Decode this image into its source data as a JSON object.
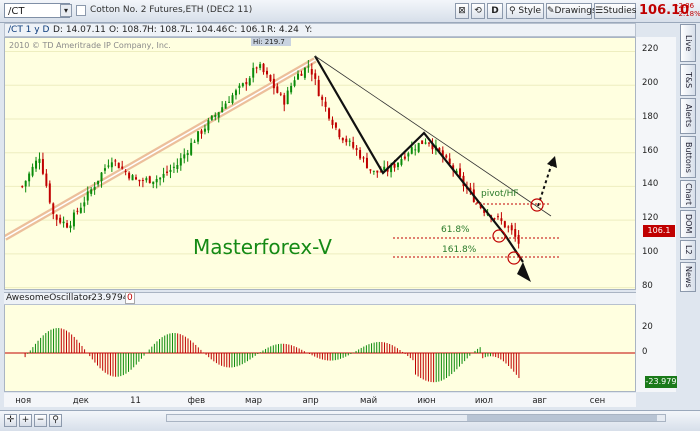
{
  "toolbar": {
    "symbol": "/CT",
    "description": "Cotton No. 2 Futures,ETH (DEC2 11)",
    "d_button": "D",
    "style_label": "Style",
    "drawings_label": "Drawings",
    "studies_label": "Studies",
    "last_price": "106.10",
    "change": "-2.36",
    "change_pct": "-2.18%"
  },
  "infobar": {
    "title": "/CT 1 y D",
    "date": "D: 14.07.11",
    "open": "O: 108.7",
    "high": "H: 108.7",
    "low": "L: 104.46",
    "close": "C: 106.1",
    "range": "R: 4.24",
    "y": "Y:"
  },
  "chart": {
    "copyright": "2010 © TD Ameritrade IP Company, Inc.",
    "hi_label": "Hi: 219.7",
    "watermark": "Masterforex-V",
    "label_pivot": "pivot/HF",
    "label_fib1": "61.8%",
    "label_fib2": "161.8%",
    "current_price_tag": "106.1",
    "colors": {
      "up": "#0a8a0a",
      "down": "#c00000",
      "background": "#ffffe0",
      "watermark": "#158a15",
      "trend_channel": "#e8a080"
    }
  },
  "chart_data": [
    {
      "type": "candlestick",
      "title": "/CT 1 y D",
      "y_ticks": [
        80,
        100,
        120,
        140,
        160,
        180,
        200,
        220
      ],
      "ylim": [
        78,
        228
      ],
      "x_tick_labels": [
        "ноя",
        "дек",
        "11",
        "фев",
        "мар",
        "апр",
        "май",
        "июн",
        "июл",
        "авг",
        "сен"
      ],
      "x_months": [
        0,
        1,
        2,
        3,
        4,
        5,
        6,
        7,
        8,
        9,
        10
      ],
      "close_series_approx": [
        {
          "m": 0.0,
          "v": 140
        },
        {
          "m": 0.3,
          "v": 158
        },
        {
          "m": 0.55,
          "v": 122
        },
        {
          "m": 0.8,
          "v": 117
        },
        {
          "m": 1.2,
          "v": 138
        },
        {
          "m": 1.55,
          "v": 157
        },
        {
          "m": 1.75,
          "v": 150
        },
        {
          "m": 2.0,
          "v": 143
        },
        {
          "m": 2.4,
          "v": 145
        },
        {
          "m": 2.7,
          "v": 153
        },
        {
          "m": 3.0,
          "v": 168
        },
        {
          "m": 3.3,
          "v": 180
        },
        {
          "m": 3.6,
          "v": 192
        },
        {
          "m": 3.85,
          "v": 200
        },
        {
          "m": 4.1,
          "v": 212
        },
        {
          "m": 4.3,
          "v": 203
        },
        {
          "m": 4.55,
          "v": 190
        },
        {
          "m": 4.75,
          "v": 205
        },
        {
          "m": 5.0,
          "v": 212
        },
        {
          "m": 5.2,
          "v": 192
        },
        {
          "m": 5.5,
          "v": 172
        },
        {
          "m": 5.85,
          "v": 160
        },
        {
          "m": 6.1,
          "v": 148
        },
        {
          "m": 6.4,
          "v": 150
        },
        {
          "m": 6.75,
          "v": 162
        },
        {
          "m": 7.05,
          "v": 168
        },
        {
          "m": 7.25,
          "v": 160
        },
        {
          "m": 7.5,
          "v": 150
        },
        {
          "m": 7.7,
          "v": 140
        },
        {
          "m": 8.0,
          "v": 127
        },
        {
          "m": 8.3,
          "v": 120
        },
        {
          "m": 8.5,
          "v": 114
        },
        {
          "m": 8.65,
          "v": 106
        }
      ],
      "annotations": [
        "pivot/HF",
        "61.8%",
        "161.8%",
        "Masterforex-V"
      ]
    },
    {
      "type": "bar",
      "title": "AwesomeOscillator",
      "last_value": -23.9794,
      "y_ticks": [
        20,
        0
      ],
      "ylim": [
        -30,
        30
      ]
    }
  ],
  "oscillator": {
    "name": "AwesomeOscillator",
    "value": "-23.9794",
    "zero": "0",
    "tag": "-23.979",
    "ticks": [
      "20",
      "0"
    ]
  },
  "side_tabs": [
    "Live",
    "T&S",
    "Alerts",
    "Buttons",
    "Chart",
    "DOM",
    "L2",
    "News"
  ],
  "icons": [
    "dropdown-arrow-icon",
    "pin-icon",
    "settings-icon",
    "zoom-in-icon",
    "zoom-out-icon",
    "pan-icon"
  ]
}
